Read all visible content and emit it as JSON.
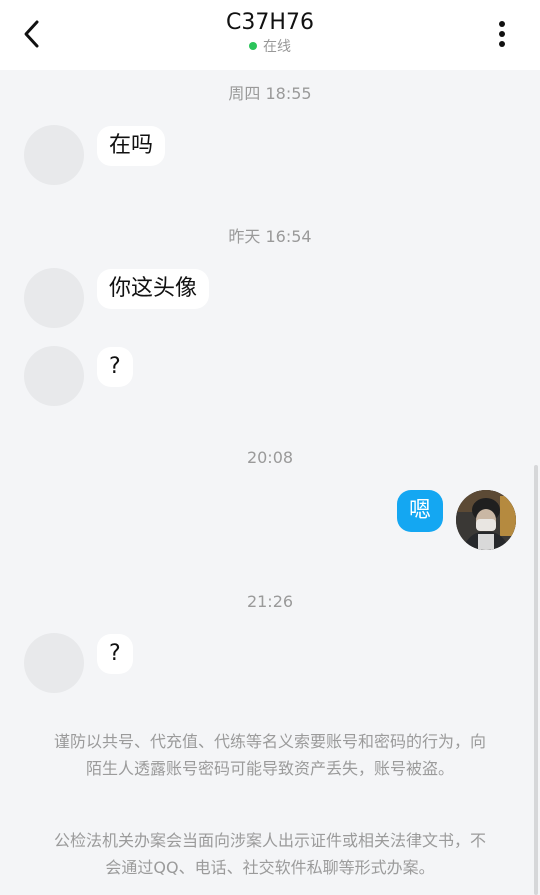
{
  "header": {
    "title": "C37H76",
    "status": "在线",
    "back_icon": "chevron-left-icon",
    "more_icon": "more-vertical-icon"
  },
  "colors": {
    "online": "#2bc45a",
    "outgoing_bubble": "#14a7f2",
    "background": "#f4f5f7"
  },
  "messages": [
    {
      "time": "周四 18:55",
      "text": "在吗",
      "sender": "other"
    },
    {
      "time": "昨天 16:54",
      "text": "你这头像",
      "sender": "other"
    },
    {
      "time": "",
      "text": "?",
      "sender": "other"
    },
    {
      "time": "20:08",
      "text": "嗯",
      "sender": "self"
    },
    {
      "time": "21:26",
      "text": "?",
      "sender": "other"
    }
  ],
  "notices": [
    "谨防以共号、代充值、代练等名义索要账号和密码的行为，向陌生人透露账号密码可能导致资产丢失，账号被盗。",
    "公检法机关办案会当面向涉案人出示证件或相关法律文书，不会通过QQ、电话、社交软件私聊等形式办案。"
  ]
}
